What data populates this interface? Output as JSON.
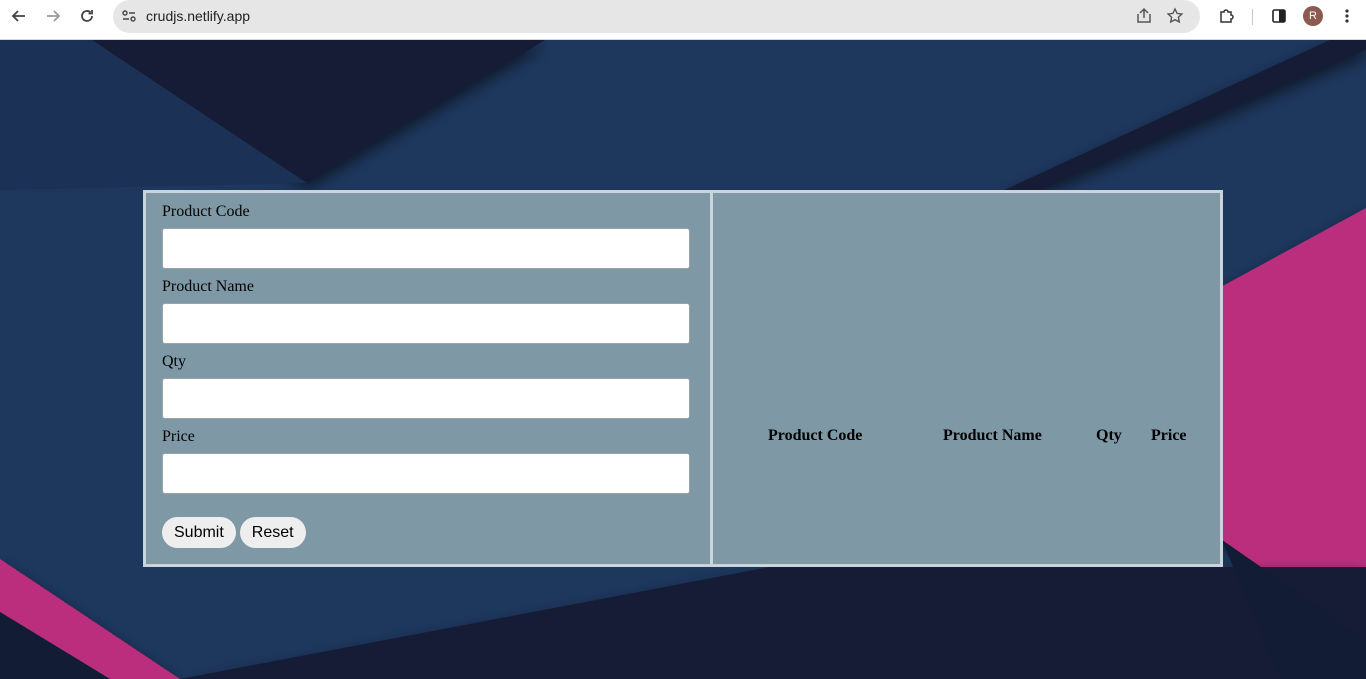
{
  "browser": {
    "url": "crudjs.netlify.app",
    "profile_initial": "R",
    "icons": {
      "back": "arrow-left-icon",
      "forward": "arrow-right-icon",
      "reload": "reload-icon",
      "site_info": "site-info-icon",
      "share": "share-icon",
      "bookmark": "star-icon",
      "extensions": "puzzle-icon",
      "side_panel": "side-panel-icon",
      "menu": "kebab-menu-icon"
    }
  },
  "form": {
    "fields": [
      {
        "label": "Product Code",
        "value": ""
      },
      {
        "label": "Product Name",
        "value": ""
      },
      {
        "label": "Qty",
        "value": ""
      },
      {
        "label": "Price",
        "value": ""
      }
    ],
    "submit_label": "Submit",
    "reset_label": "Reset"
  },
  "list": {
    "columns": [
      "Product Code",
      "Product Name",
      "Qty",
      "Price"
    ],
    "rows": []
  },
  "colors": {
    "background_navy": "#1d375d",
    "accent_pink": "#bb2f7e",
    "panel": "#7e99a5"
  }
}
